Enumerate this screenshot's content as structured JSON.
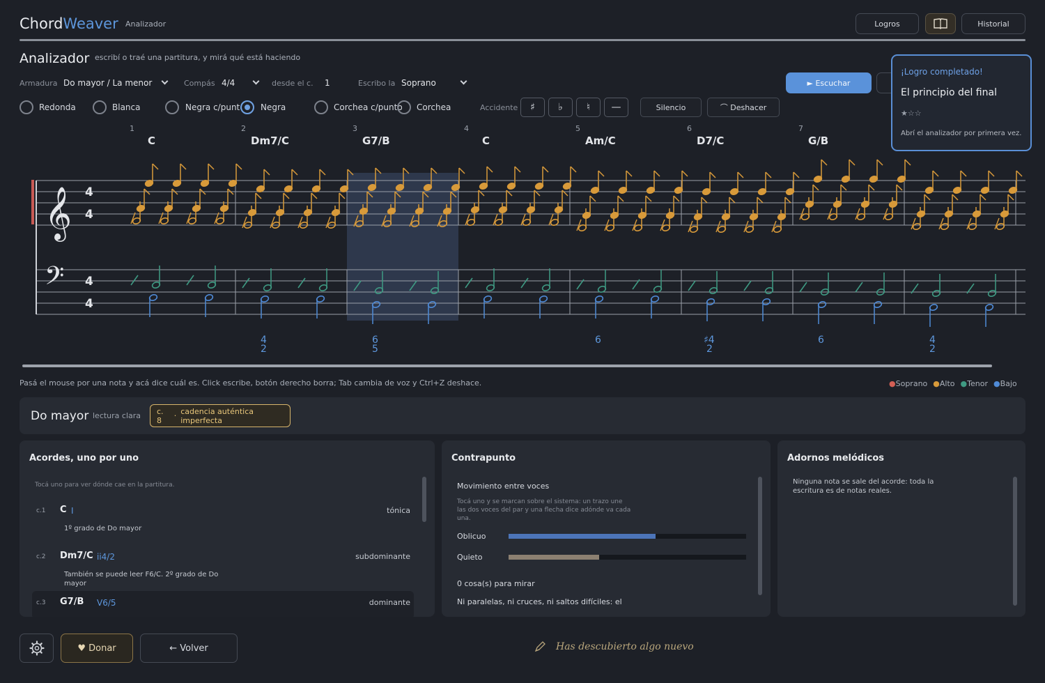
{
  "header": {
    "brand_a": "Chord",
    "brand_b": "Weaver",
    "crumb": "Analizador",
    "buttons": [
      "Logros",
      "Historial"
    ],
    "book_icon": "book-icon"
  },
  "analyzer": {
    "title": "Analizador",
    "subtitle": "escribí o traé una partitura, y mirá qué está haciendo",
    "armadura_label": "Armadura",
    "armadura_value": "Do mayor / La menor",
    "compas_label": "Compás",
    "compas_value": "4/4",
    "desde_label": "desde el c.",
    "desde_value": "1",
    "escribo_label": "Escribo la",
    "escribo_value": "Soprano",
    "escuchar": "► Escuchar"
  },
  "durations": [
    {
      "label": "Redonda",
      "selected": false
    },
    {
      "label": "Blanca",
      "selected": false
    },
    {
      "label": "Negra c/punto",
      "selected": false
    },
    {
      "label": "Negra",
      "selected": true
    },
    {
      "label": "Corchea c/punto",
      "selected": false
    },
    {
      "label": "Corchea",
      "selected": false
    }
  ],
  "accidentals": {
    "label": "Accidente",
    "symbols": [
      "♯",
      "♭",
      "♮",
      "—"
    ],
    "silencio": "Silencio",
    "deshacer": "⌒ Deshacer"
  },
  "toast": {
    "heading": "¡Logro completado!",
    "title": "El principio del final",
    "stars": "★☆☆",
    "desc": "Abrí el analizador por primera vez."
  },
  "score": {
    "measures": [
      {
        "num": "1",
        "chord": "C",
        "fig_top": "",
        "fig_bot": ""
      },
      {
        "num": "2",
        "chord": "Dm7/C",
        "fig_top": "4",
        "fig_bot": "2"
      },
      {
        "num": "3",
        "chord": "G7/B",
        "fig_top": "6",
        "fig_bot": "5"
      },
      {
        "num": "4",
        "chord": "C",
        "fig_top": "",
        "fig_bot": ""
      },
      {
        "num": "5",
        "chord": "Am/C",
        "fig_top": "6",
        "fig_bot": ""
      },
      {
        "num": "6",
        "chord": "D7/C",
        "fig_top": "♯4",
        "fig_bot": "2"
      },
      {
        "num": "7",
        "chord": "G/B",
        "fig_top": "6",
        "fig_bot": ""
      },
      {
        "num": "",
        "chord": "",
        "fig_top": "4",
        "fig_bot": "2"
      }
    ],
    "time_sig": "4",
    "colors": {
      "alto": "#d89a3a",
      "tenor": "#3f9a83",
      "bajo": "#4f8ad6",
      "soprano": "#d35f55"
    }
  },
  "hint": "Pasá el mouse por una nota y acá dice cuál es. Click escribe, botón derecho borra; Tab cambia de voz y Ctrl+Z deshace.",
  "legend": [
    {
      "label": "Soprano",
      "color": "#d35f55"
    },
    {
      "label": "Alto",
      "color": "#d89a3a"
    },
    {
      "label": "Tenor",
      "color": "#3f9a83"
    },
    {
      "label": "Bajo",
      "color": "#4f8ad6"
    }
  ],
  "key_summary": {
    "key": "Do mayor",
    "reading": "lectura clara",
    "badge_measure": "c. 8",
    "badge_text": "cadencia auténtica imperfecta"
  },
  "chords_panel": {
    "title": "Acordes, uno por uno",
    "hint": "Tocá uno para ver dónde cae en la partitura.",
    "items": [
      {
        "m": "c.1",
        "name": "C",
        "roman": "I",
        "func": "tónica",
        "desc": "1º grado de Do mayor"
      },
      {
        "m": "c.2",
        "name": "Dm7/C",
        "roman": "ii4/2",
        "func": "subdominante",
        "desc": "También se puede leer F6/C. 2º grado de Do mayor"
      },
      {
        "m": "c.3",
        "name": "G7/B",
        "roman": "V6/5",
        "func": "dominante",
        "desc": ""
      }
    ]
  },
  "counterpoint": {
    "title": "Contrapunto",
    "section": "Movimiento entre voces",
    "desc": "Tocá uno y se marcan sobre el sistema: un trazo une las dos voces del par y una flecha dice adónde va cada una.",
    "bars": [
      {
        "label": "Oblicuo",
        "value": 0.62,
        "color": "#4c74b8"
      },
      {
        "label": "Quieto",
        "value": 0.38,
        "color": "#8c8071"
      }
    ],
    "count": "0 cosa(s) para mirar",
    "note": "Ni paralelas, ni cruces, ni saltos difíciles: el"
  },
  "ornaments": {
    "title": "Adornos melódicos",
    "desc": "Ninguna nota se sale del acorde: toda la escritura es de notas reales."
  },
  "footer": {
    "settings_icon": "gear-icon",
    "donar": "♥  Donar",
    "volver": "←  Volver",
    "discovery": "Has descubierto algo nuevo"
  }
}
